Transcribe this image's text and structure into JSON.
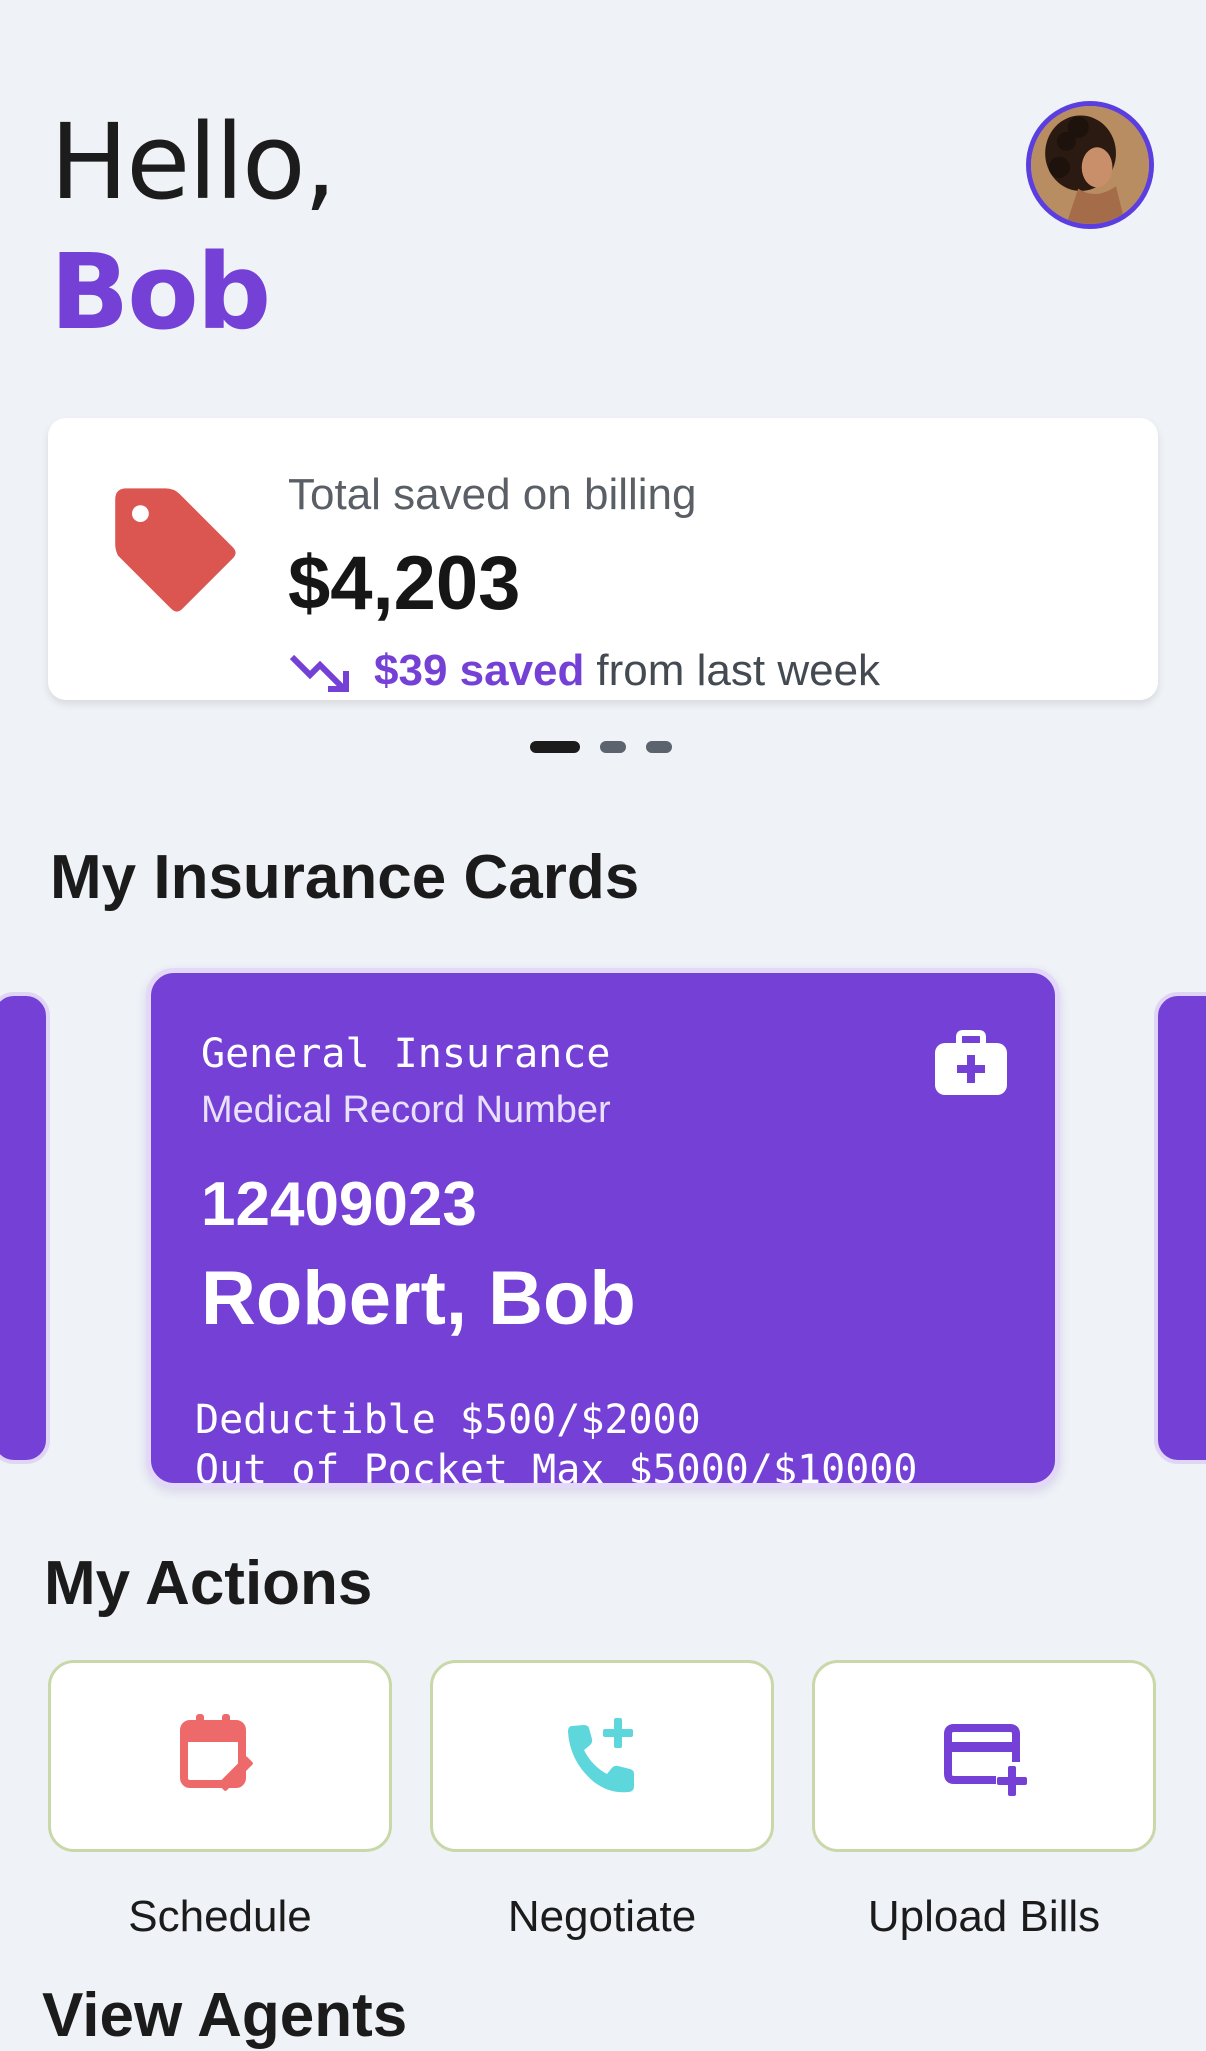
{
  "greeting": {
    "hello": "Hello,",
    "name": "Bob"
  },
  "avatar": {
    "icon": "user-avatar-photo"
  },
  "savings": {
    "label": "Total saved on billing",
    "amount": "$4,203",
    "trend_amount": "$39 saved",
    "trend_text": "from last week",
    "icon": "price-tag-icon",
    "trend_icon": "trending-down-icon",
    "tag_color": "#dc5651",
    "accent_color": "#7440d6"
  },
  "carousel": {
    "page_count": 3,
    "active_page": 1
  },
  "insurance": {
    "title": "My Insurance Cards",
    "cards": [
      {
        "type": "General Insurance",
        "mrn_label": "Medical Record Number",
        "number": "12409023",
        "name": "Robert, Bob",
        "deductible": "Deductible $500/$2000",
        "oop": "Out of Pocket Max $5000/$10000",
        "icon": "medical-kit-icon",
        "color": "#7440d6"
      }
    ]
  },
  "actions": {
    "title": "My Actions",
    "items": [
      {
        "label": "Schedule",
        "icon": "calendar-edit-icon",
        "color": "#ee6a6a"
      },
      {
        "label": "Negotiate",
        "icon": "phone-add-icon",
        "color": "#5dd6dc"
      },
      {
        "label": "Upload Bills",
        "icon": "card-add-icon",
        "color": "#7440d6"
      }
    ]
  },
  "agents": {
    "title": "View Agents"
  }
}
